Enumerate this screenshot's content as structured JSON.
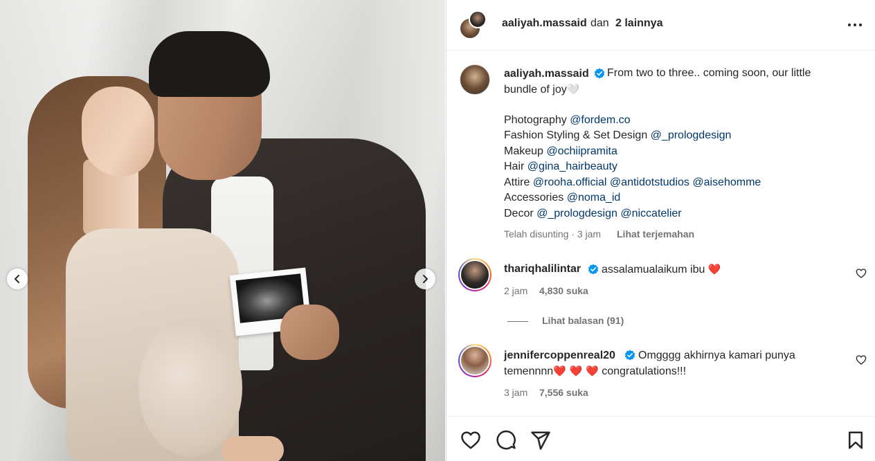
{
  "post_header": {
    "username": "aaliyah.massaid",
    "and_text": "dan",
    "others_text": "2 lainnya"
  },
  "caption": {
    "username": "aaliyah.massaid",
    "line1": "From two to three.. coming soon, our little",
    "line2": "bundle of joy",
    "line2_emoji": "🤍",
    "credits": [
      {
        "label": "Photography",
        "mentions": [
          "@fordem.co"
        ]
      },
      {
        "label": "Fashion Styling & Set Design",
        "mentions": [
          "@_prologdesign"
        ]
      },
      {
        "label": "Makeup",
        "mentions": [
          "@ochiipramita"
        ]
      },
      {
        "label": "Hair",
        "mentions": [
          "@gina_hairbeauty"
        ]
      },
      {
        "label": "Attire",
        "mentions": [
          "@rooha.official",
          "@antidotstudios",
          "@aisehomme"
        ]
      },
      {
        "label": "Accessories",
        "mentions": [
          "@noma_id"
        ]
      },
      {
        "label": "Decor",
        "mentions": [
          "@_prologdesign",
          "@niccatelier"
        ]
      }
    ],
    "edited": "Telah disunting",
    "separator": "·",
    "time": "3 jam",
    "translate": "Lihat terjemahan"
  },
  "comments": [
    {
      "username": "thariqhalilintar",
      "text": "assalamualaikum ibu",
      "emoji": "❤️",
      "time": "2 jam",
      "likes": "4,830 suka",
      "view_replies": "Lihat balasan (91)"
    },
    {
      "username": "jennifercoppenreal20",
      "line1": "Omgggg akhirnya kamari punya",
      "line2_prefix": "temennnn",
      "line2_emojis": "❤️ ❤️ ❤️",
      "line2_suffix": "congratulations!!!",
      "time": "3 jam",
      "likes": "7,556 suka"
    }
  ],
  "icons": {
    "verified_color": "#0095f6",
    "heart_red": "#ff3040",
    "link_color": "#00376b",
    "ring_gradient": [
      "#feda75",
      "#fa7e1e",
      "#d62976",
      "#962fbf",
      "#4f5bd5"
    ]
  }
}
